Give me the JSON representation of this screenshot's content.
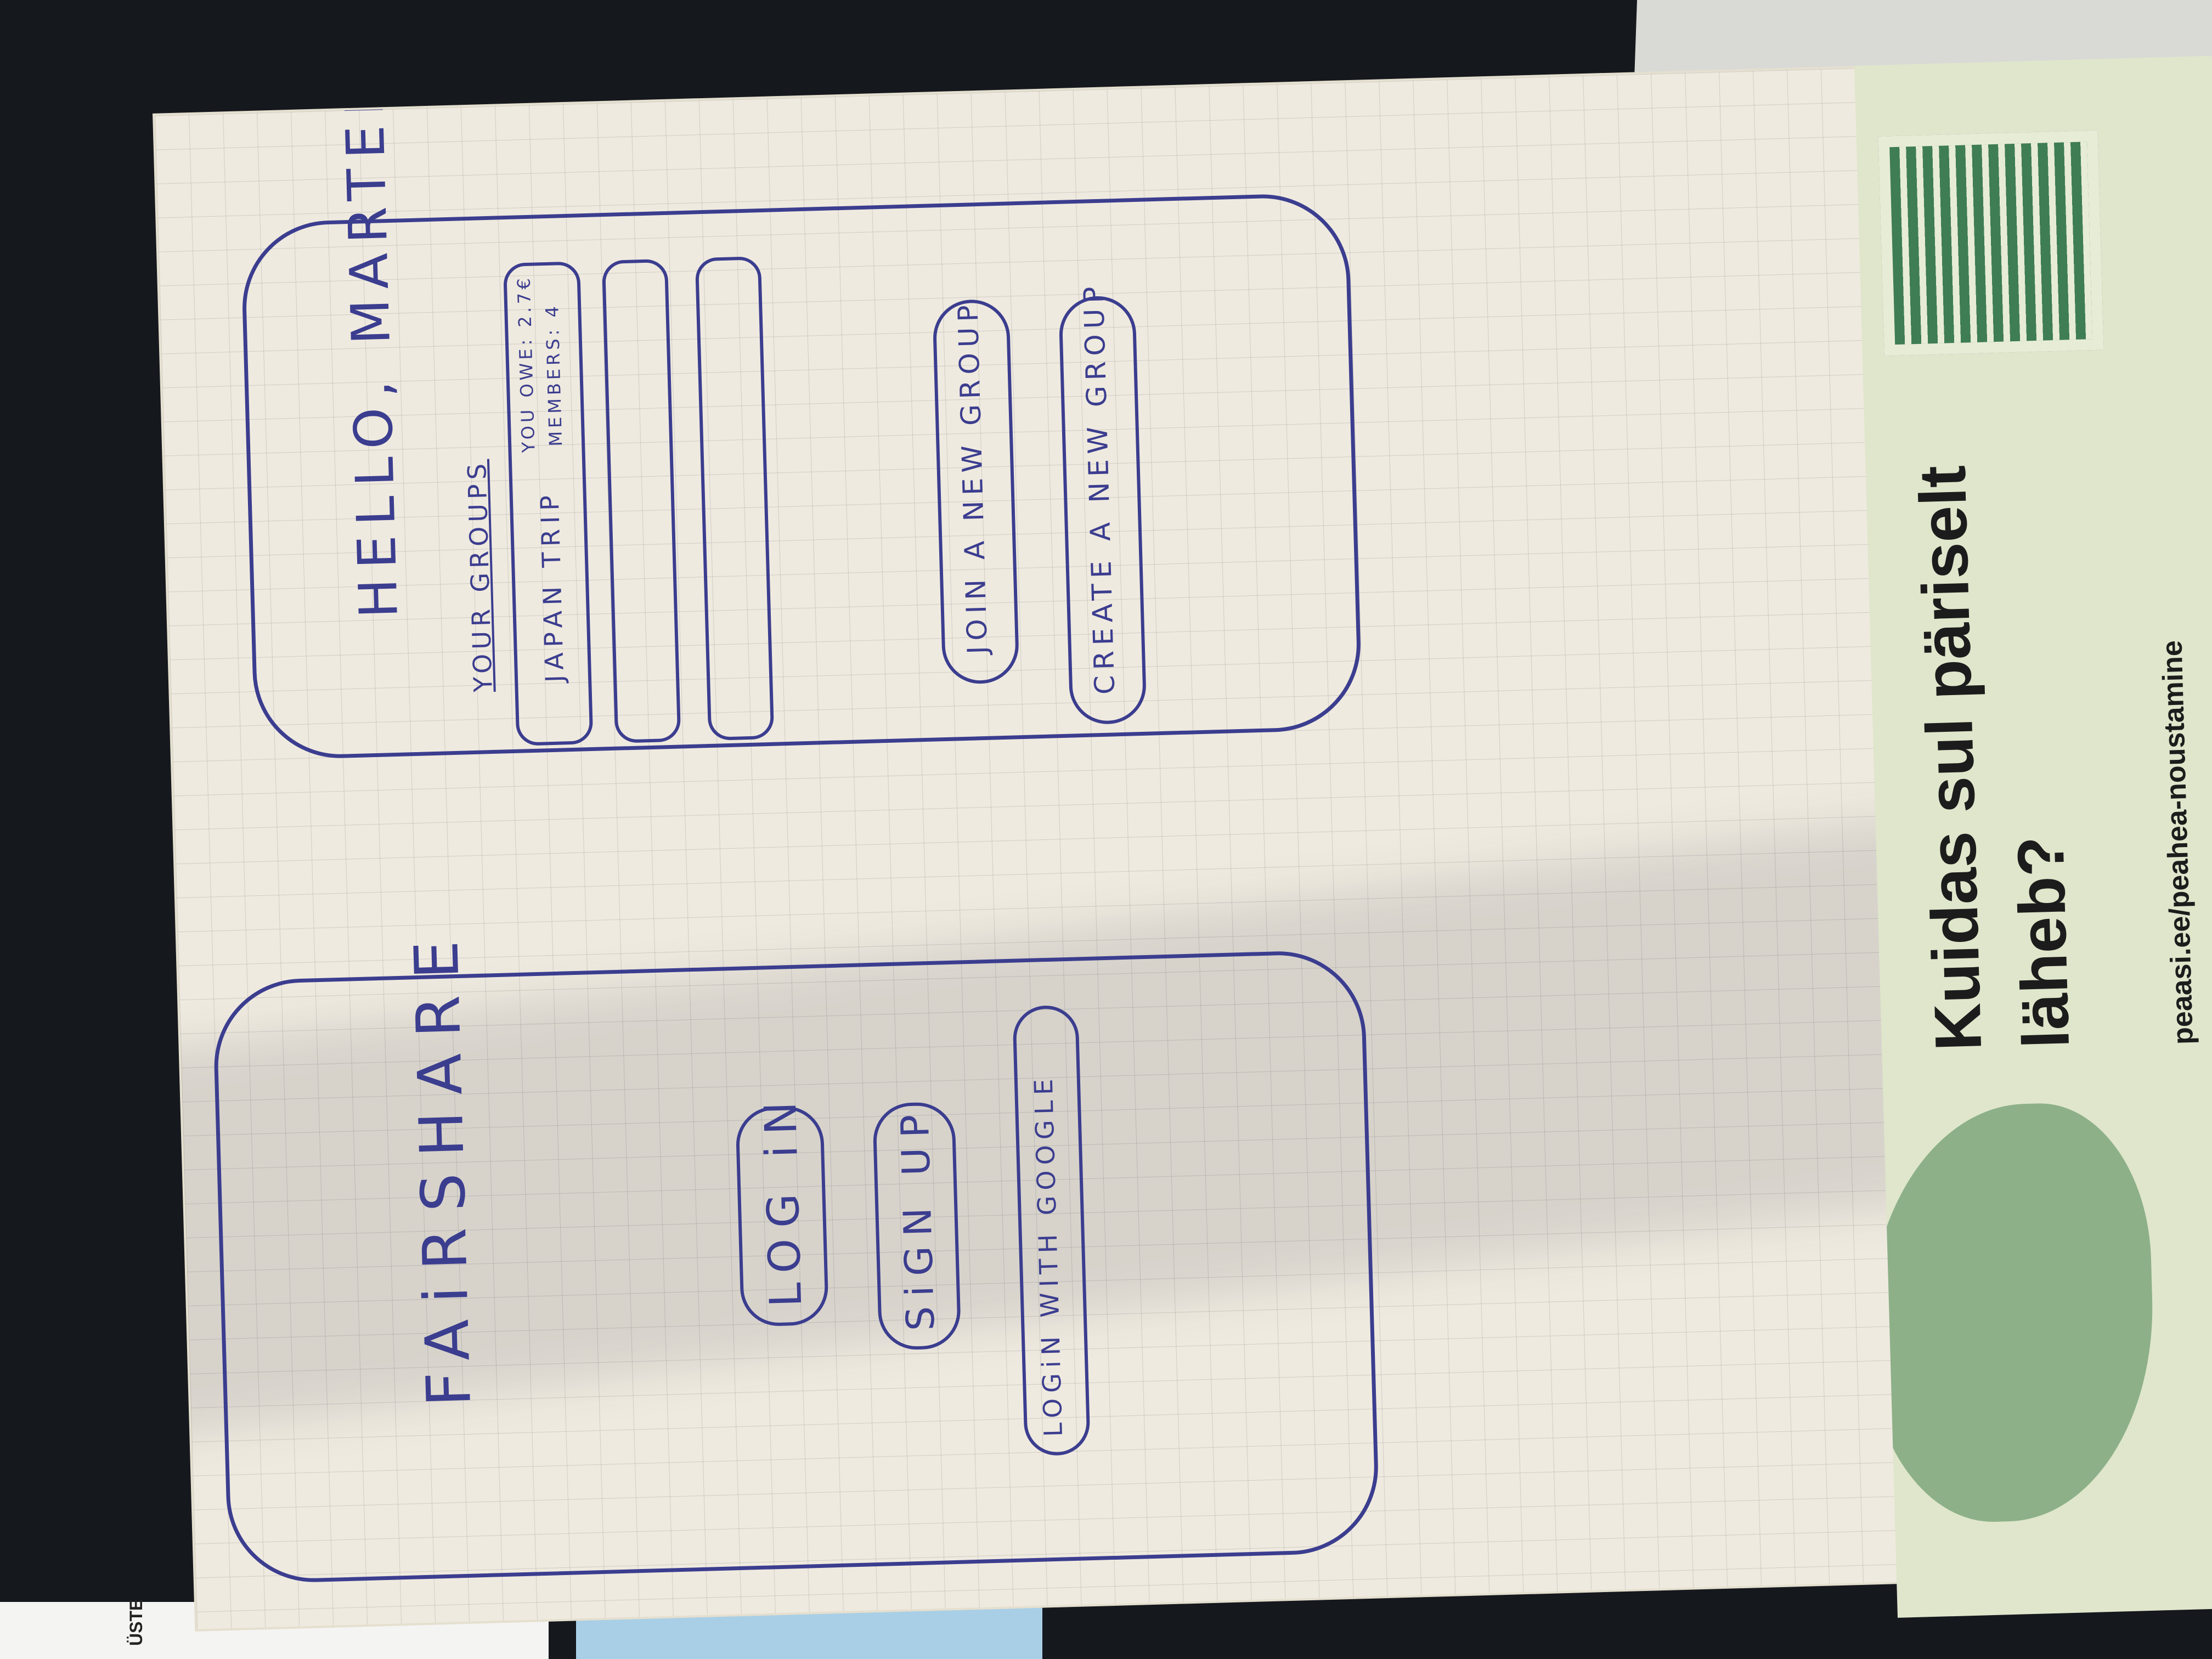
{
  "sketch": {
    "login_screen": {
      "title": "FAiRSHARE",
      "login_button": "LOG iN",
      "signup_button": "SiGN UP",
      "google_button": "LOGiN WITH GOOGLE"
    },
    "groups_screen": {
      "greeting": "HELLO, MARTEN!",
      "section_label": "YOUR GROUPS",
      "group_name": "JAPAN TRIP",
      "group_owe": "YOU OWE: 2.7€",
      "group_members": "MEMBERS: 4",
      "join_button": "JOIN A NEW GROUP",
      "create_button": "CREATE A NEW GROUP"
    }
  },
  "leaflet": {
    "headline_line1": "Kuidas sul päriselt",
    "headline_line2": "läheb?",
    "url": "peaasi.ee/peahea-noustamine"
  },
  "background": {
    "corner_text": "ÜSTE"
  }
}
